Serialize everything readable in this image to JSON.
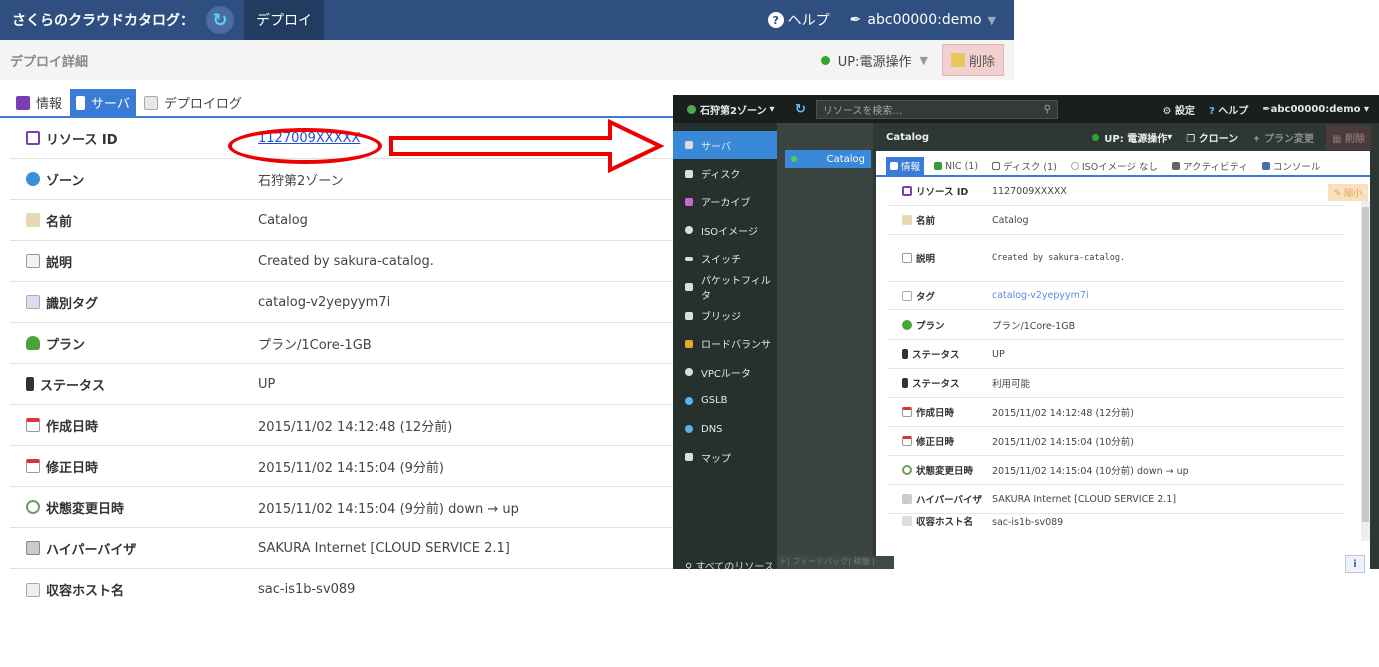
{
  "left": {
    "app_title": "さくらのクラウドカタログ：",
    "deploy_tab": "デプロイ",
    "help": "ヘルプ",
    "user": "abc00000:demo",
    "subtitle": "デプロイ詳細",
    "power_label": "UP:電源操作",
    "delete_label": "削除",
    "tabs": [
      "情報",
      "サーバ",
      "デプロイログ"
    ],
    "rows": [
      {
        "k": "リソース ID",
        "v": "1127009XXXXX"
      },
      {
        "k": "ゾーン",
        "v": "石狩第2ゾーン"
      },
      {
        "k": "名前",
        "v": "Catalog"
      },
      {
        "k": "説明",
        "v": "Created by sakura-catalog."
      },
      {
        "k": "識別タグ",
        "v": "catalog-v2yepyym7i"
      },
      {
        "k": "プラン",
        "v": "プラン/1Core-1GB"
      },
      {
        "k": "ステータス",
        "v": "UP"
      },
      {
        "k": "作成日時",
        "v": "2015/11/02 14:12:48 (12分前)"
      },
      {
        "k": "修正日時",
        "v": "2015/11/02 14:15:04 (9分前)"
      },
      {
        "k": "状態変更日時",
        "v": "2015/11/02 14:15:04 (9分前) down → up"
      },
      {
        "k": "ハイパーバイザ",
        "v": "SAKURA Internet [CLOUD SERVICE 2.1]"
      },
      {
        "k": "収容ホスト名",
        "v": "sac-is1b-sv089"
      }
    ]
  },
  "right": {
    "zone": "石狩第2ゾーン",
    "search_placeholder": "リソースを検索...",
    "settings": "設定",
    "help": "ヘルプ",
    "user": "abc00000:demo",
    "sidebar": [
      "サーバ",
      "ディスク",
      "アーカイブ",
      "ISOイメージ",
      "スイッチ",
      "パケットフィルタ",
      "ブリッジ",
      "ロードバランサ",
      "VPCルータ",
      "GSLB",
      "DNS",
      "マップ"
    ],
    "all_resources": "すべてのリソース",
    "list_item": "Catalog",
    "header_title": "Catalog",
    "power_label": "UP: 電源操作",
    "clone_label": "クローン",
    "plan_change_label": "プラン変更",
    "delete_label": "削除",
    "tabs": [
      "情報",
      "NIC (1)",
      "ディスク (1)",
      "ISOイメージ なし",
      "アクティビティ",
      "コンソール"
    ],
    "collapse_label": "縮小",
    "footer_text": "ト| フィードバック| 稼働 |",
    "rows": [
      {
        "k": "リソース ID",
        "v": "1127009XXXXX"
      },
      {
        "k": "名前",
        "v": "Catalog"
      },
      {
        "k": "説明",
        "v": "Created by sakura-catalog."
      },
      {
        "k": "タグ",
        "v": "catalog-v2yepyym7i"
      },
      {
        "k": "プラン",
        "v": "プラン/1Core-1GB"
      },
      {
        "k": "ステータス",
        "v": "UP"
      },
      {
        "k": "ステータス",
        "v": "利用可能"
      },
      {
        "k": "作成日時",
        "v": "2015/11/02 14:12:48 (12分前)"
      },
      {
        "k": "修正日時",
        "v": "2015/11/02 14:15:04 (10分前)"
      },
      {
        "k": "状態変更日時",
        "v": "2015/11/02 14:15:04 (10分前) down → up"
      },
      {
        "k": "ハイパーバイザ",
        "v": "SAKURA Internet [CLOUD SERVICE 2.1]"
      },
      {
        "k": "収容ホスト名",
        "v": "sac-is1b-sv089"
      }
    ]
  }
}
